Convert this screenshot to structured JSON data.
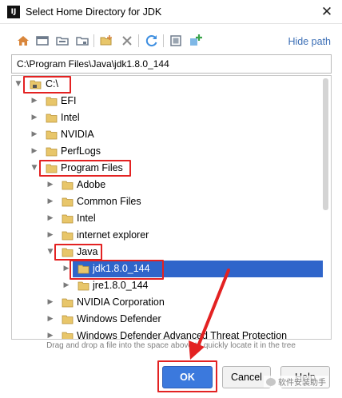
{
  "window": {
    "title": "Select Home Directory for JDK",
    "app_icon": "IJ",
    "close_icon": "close-icon"
  },
  "toolbar": {
    "icons": [
      "home-icon",
      "desktop-icon",
      "project-icon",
      "module-icon",
      "new-folder-icon",
      "delete-icon",
      "refresh-icon",
      "show-hidden-icon",
      "add-icon"
    ],
    "hide_path_label": "Hide path"
  },
  "path_field": {
    "value": "C:\\Program Files\\Java\\jdk1.8.0_144"
  },
  "tree": {
    "items": [
      {
        "label": "C:\\",
        "expanded": true,
        "icon": "drive-icon"
      },
      {
        "label": "EFI",
        "expanded": false,
        "icon": "folder-icon"
      },
      {
        "label": "Intel",
        "expanded": false,
        "icon": "folder-icon"
      },
      {
        "label": "NVIDIA",
        "expanded": false,
        "icon": "folder-icon"
      },
      {
        "label": "PerfLogs",
        "expanded": false,
        "icon": "folder-icon"
      },
      {
        "label": "Program Files",
        "expanded": true,
        "icon": "folder-icon"
      },
      {
        "label": "Adobe",
        "expanded": false,
        "icon": "folder-icon"
      },
      {
        "label": "Common Files",
        "expanded": false,
        "icon": "folder-icon"
      },
      {
        "label": "Intel",
        "expanded": false,
        "icon": "folder-icon"
      },
      {
        "label": "internet explorer",
        "expanded": false,
        "icon": "folder-icon"
      },
      {
        "label": "Java",
        "expanded": true,
        "icon": "folder-icon"
      },
      {
        "label": "jdk1.8.0_144",
        "expanded": false,
        "selected": true,
        "icon": "folder-icon"
      },
      {
        "label": "jre1.8.0_144",
        "expanded": false,
        "icon": "folder-icon"
      },
      {
        "label": "NVIDIA Corporation",
        "expanded": false,
        "icon": "folder-icon"
      },
      {
        "label": "Windows Defender",
        "expanded": false,
        "icon": "folder-icon"
      },
      {
        "label": "Windows Defender Advanced Threat Protection",
        "expanded": false,
        "icon": "folder-icon"
      }
    ]
  },
  "hint": "Drag and drop a file into the space above to quickly locate it in the tree",
  "buttons": {
    "ok": "OK",
    "cancel": "Cancel",
    "help": "Help"
  },
  "watermark": "软件安装助手",
  "colors": {
    "selection": "#2f65ca",
    "highlight_box": "#e32222",
    "ok_button": "#3b79dd",
    "link": "#3c6fb6",
    "folder": "#e8c66a"
  }
}
